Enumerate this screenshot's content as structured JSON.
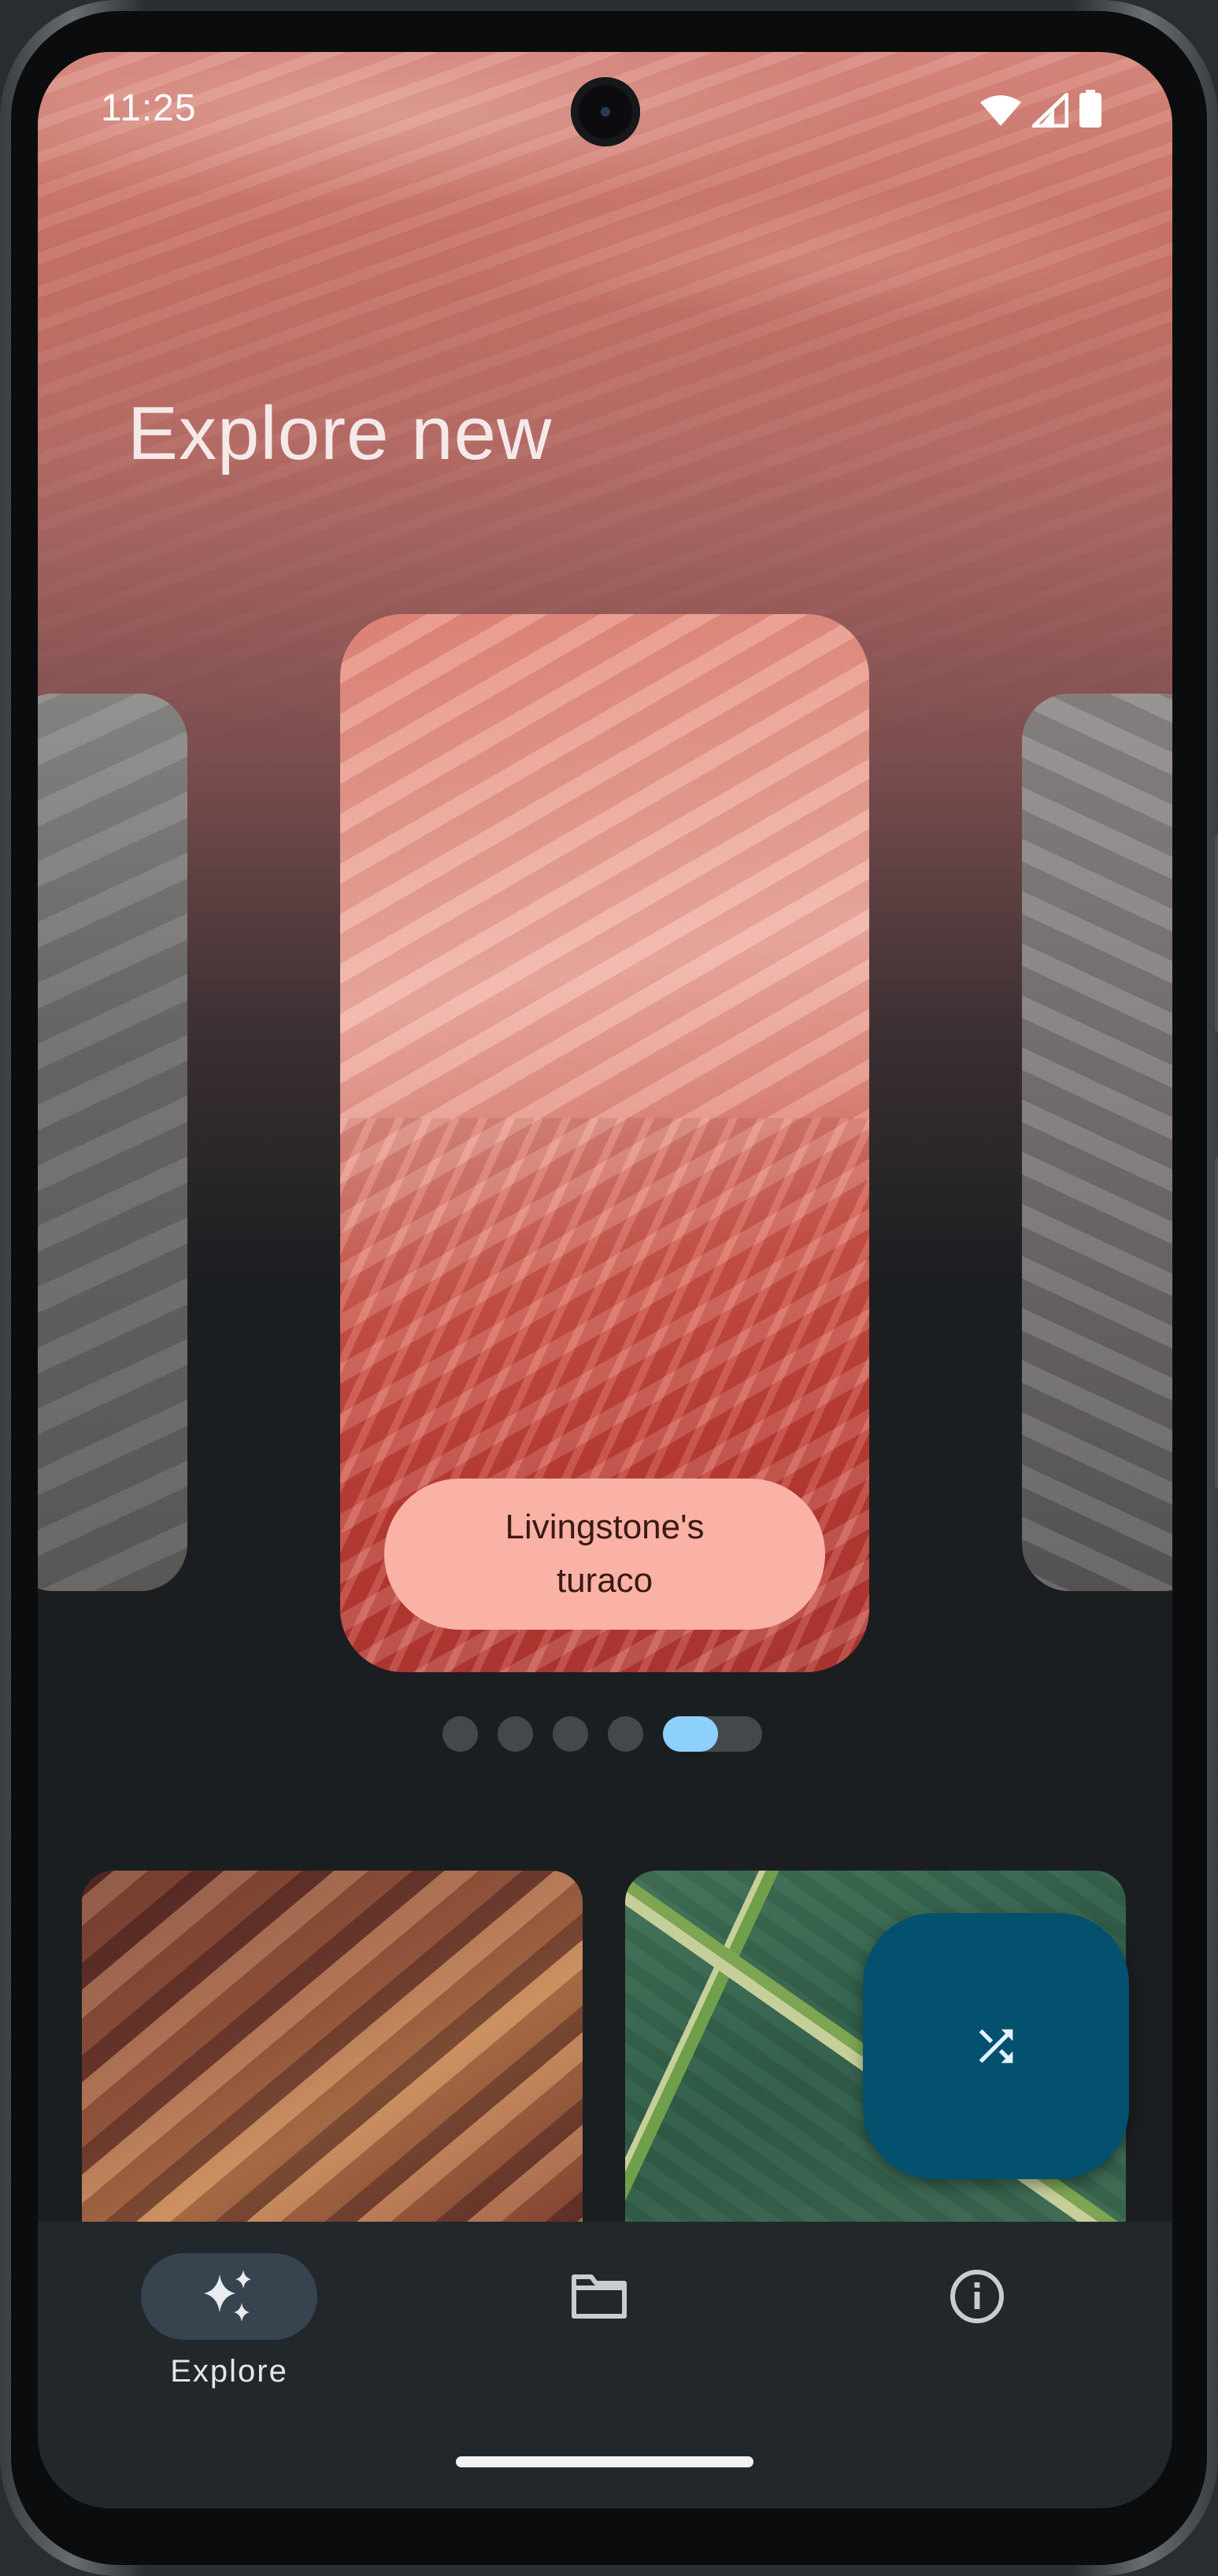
{
  "status_bar": {
    "time": "11:25",
    "icons": [
      "wifi-icon",
      "signal-icon",
      "battery-icon"
    ]
  },
  "header": {
    "title": "Explore new"
  },
  "carousel": {
    "cards": [
      {
        "name": "wallpaper-card-left",
        "position": "previous"
      },
      {
        "name": "wallpaper-card-current",
        "label": "Livingstone's turaco"
      },
      {
        "name": "wallpaper-card-right",
        "position": "next"
      }
    ],
    "page_count": 5,
    "active_page": 5
  },
  "thumbnails": [
    {
      "name": "desert-rocks",
      "description_icon": "image"
    },
    {
      "name": "green-fields",
      "description_icon": "image"
    }
  ],
  "fab": {
    "icon": "shuffle-icon"
  },
  "bottom_nav": {
    "items": [
      {
        "label": "Explore",
        "icon": "sparkle-icon",
        "selected": true
      },
      {
        "label": "",
        "icon": "folder-icon",
        "selected": false
      },
      {
        "label": "",
        "icon": "info-icon",
        "selected": false
      }
    ]
  },
  "colors": {
    "accent": "#8dd0fb",
    "fab": "#03506f",
    "label_pill": "#f9b2a5",
    "nav_background": "#22272c"
  }
}
